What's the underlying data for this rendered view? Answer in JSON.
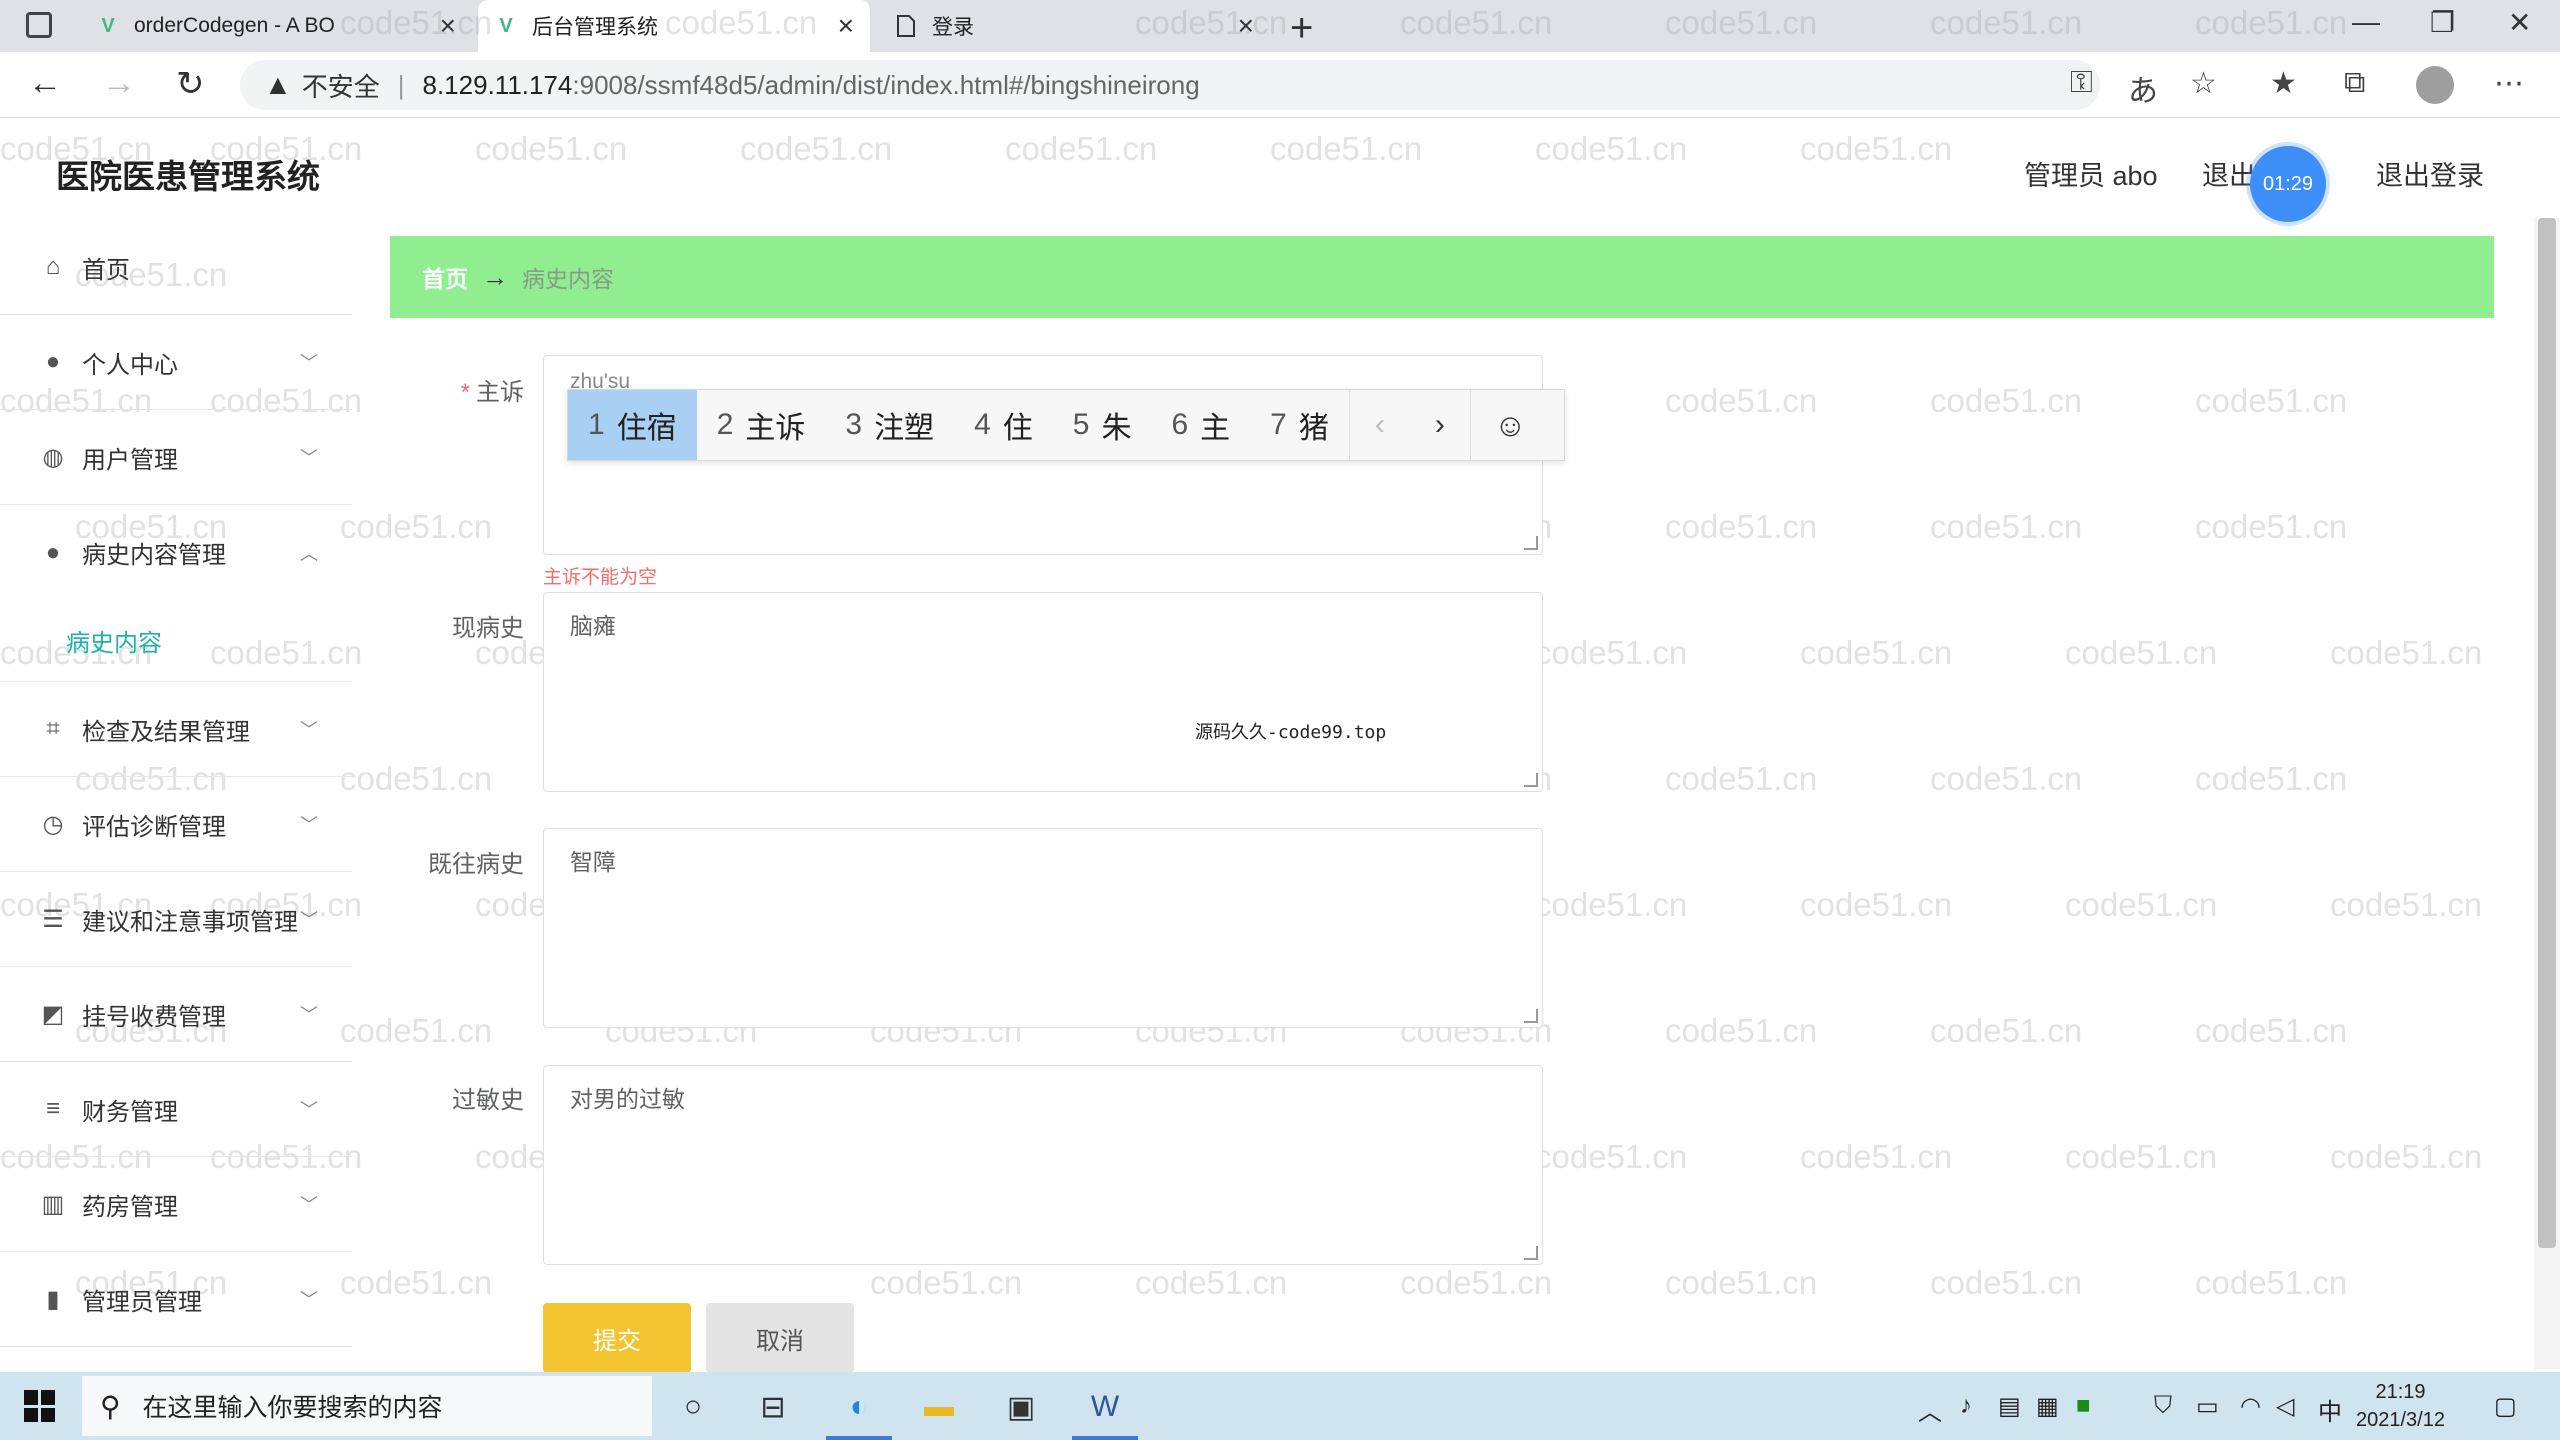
{
  "browser": {
    "tabs": [
      {
        "title": "orderCodegen - A BO",
        "favicon": "vue-logo-icon"
      },
      {
        "title": "后台管理系统",
        "favicon": "vue-logo-icon"
      },
      {
        "title": "登录",
        "favicon": "page-icon"
      }
    ],
    "address": {
      "security_label": "不安全",
      "separator": "|",
      "host": "8.129.11.174",
      "path": ":9008/ssmf48d5/admin/dist/index.html#/bingshineirong"
    }
  },
  "header": {
    "title": "医院医患管理系统",
    "user": "管理员 abo",
    "logout_partial": "退出",
    "logout": "退出登录",
    "timer": "01:29"
  },
  "sidebar": {
    "items": [
      {
        "label": "首页",
        "icon": "home-icon"
      },
      {
        "label": "个人中心",
        "icon": "user-icon"
      },
      {
        "label": "用户管理",
        "icon": "microphone-icon"
      },
      {
        "label": "病史内容管理",
        "icon": "user-icon"
      },
      {
        "label": "病史内容",
        "icon": ""
      },
      {
        "label": "检查及结果管理",
        "icon": "crop-icon"
      },
      {
        "label": "评估诊断管理",
        "icon": "clock-icon"
      },
      {
        "label": "建议和注意事项管理",
        "icon": "stack-icon"
      },
      {
        "label": "挂号收费管理",
        "icon": "chart-icon"
      },
      {
        "label": "财务管理",
        "icon": "list-icon"
      },
      {
        "label": "药房管理",
        "icon": "book-icon"
      },
      {
        "label": "管理员管理",
        "icon": "bar-chart-icon"
      }
    ]
  },
  "breadcrumb": {
    "home": "首页",
    "separator": "→",
    "current": "病史内容"
  },
  "form": {
    "fields": [
      {
        "label": "主诉",
        "required": true,
        "value": "zhu'su",
        "error": "主诉不能为空"
      },
      {
        "label": "现病史",
        "required": false,
        "value": "脑瘫"
      },
      {
        "label": "既往病史",
        "required": false,
        "value": "智障"
      },
      {
        "label": "过敏史",
        "required": false,
        "value": "对男的过敏"
      }
    ],
    "submit_label": "提交",
    "cancel_label": "取消"
  },
  "ime": {
    "candidates": [
      {
        "num": "1",
        "text": "住宿"
      },
      {
        "num": "2",
        "text": "主诉"
      },
      {
        "num": "3",
        "text": "注塑"
      },
      {
        "num": "4",
        "text": "住"
      },
      {
        "num": "5",
        "text": "朱"
      },
      {
        "num": "6",
        "text": "主"
      },
      {
        "num": "7",
        "text": "猪"
      }
    ],
    "prev": "‹",
    "next": "›",
    "emoji": "☺"
  },
  "overlay_text": "源码久久-code99.top",
  "watermark": "code51.cn",
  "taskbar": {
    "search_placeholder": "在这里输入你要搜索的内容",
    "ime_indicator": "中",
    "time": "21:19",
    "date": "2021/3/12"
  }
}
